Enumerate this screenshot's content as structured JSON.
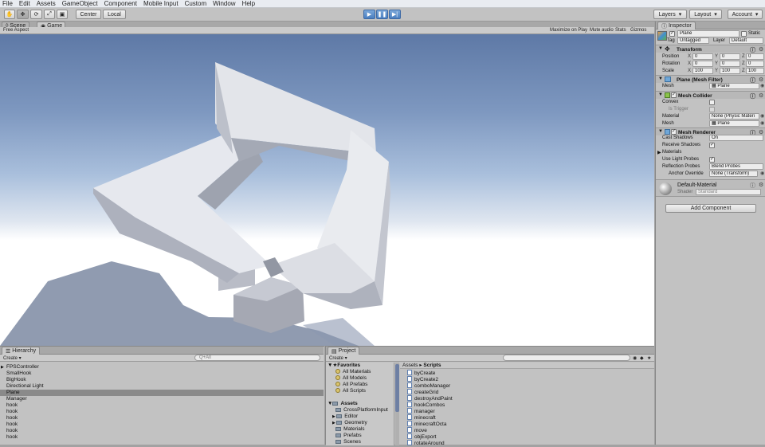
{
  "menu": [
    "File",
    "Edit",
    "Assets",
    "GameObject",
    "Component",
    "Mobile Input",
    "Custom",
    "Window",
    "Help"
  ],
  "toolbar": {
    "pivot": "Center",
    "space": "Local",
    "layers": "Layers",
    "layout": "Layout",
    "account": "Account"
  },
  "scene_tabs": {
    "scene": "Scene",
    "game": "Game"
  },
  "game_bar": {
    "aspect": "Free Aspect",
    "maximize": "Maximize on Play",
    "mute": "Mute audio",
    "stats": "Stats",
    "gizmos": "Gizmos"
  },
  "inspector": {
    "tab": "Inspector",
    "object_name": "Plane",
    "static_label": "Static",
    "tag_label": "Tag",
    "tag_value": "Untagged",
    "layer_label": "Layer",
    "layer_value": "Default",
    "transform": {
      "title": "Transform",
      "position_label": "Position",
      "rotation_label": "Rotation",
      "scale_label": "Scale",
      "position": [
        "0",
        "0",
        "0"
      ],
      "rotation": [
        "0",
        "0",
        "0"
      ],
      "scale": [
        "100",
        "100",
        "100"
      ]
    },
    "mesh_filter": {
      "title": "Plane (Mesh Filter)",
      "mesh_label": "Mesh",
      "mesh_value": "Plane"
    },
    "mesh_collider": {
      "title": "Mesh Collider",
      "convex_label": "Convex",
      "trigger_label": "Is Trigger",
      "material_label": "Material",
      "material_value": "None (Physic Materi",
      "mesh_label": "Mesh",
      "mesh_value": "Plane"
    },
    "mesh_renderer": {
      "title": "Mesh Renderer",
      "cast_label": "Cast Shadows",
      "cast_value": "On",
      "receive_label": "Receive Shadows",
      "materials_label": "Materials",
      "probes_label": "Use Light Probes",
      "reflection_label": "Reflection Probes",
      "reflection_value": "Blend Probes",
      "anchor_label": "Anchor Override",
      "anchor_value": "None (Transform)"
    },
    "material": {
      "name": "Default-Material",
      "shader_label": "Shader",
      "shader_value": "Standard"
    },
    "add_component": "Add Component"
  },
  "hierarchy": {
    "tab": "Hierarchy",
    "create": "Create",
    "search_placeholder": "Q+All",
    "items": [
      "FPSController",
      "SmallHook",
      "BigHook",
      "Directional Light",
      "Plane",
      "Manager",
      "hook",
      "hook",
      "hook",
      "hook",
      "hook",
      "hook"
    ],
    "selected_index": 4
  },
  "project": {
    "tab": "Project",
    "create": "Create",
    "favorites_label": "Favorites",
    "favorites": [
      "All Materials",
      "All Models",
      "All Prefabs",
      "All Scripts"
    ],
    "assets_label": "Assets",
    "folders": [
      "CrossPlatformInput",
      "Editor",
      "Geometry",
      "Materials",
      "Prefabs",
      "Scenes"
    ],
    "breadcrumb_root": "Assets",
    "breadcrumb_sep": "▸",
    "breadcrumb_current": "Scripts",
    "scripts": [
      "byCreate",
      "byCreate2",
      "comboManager",
      "createGrid",
      "destroyAndPaint",
      "hookCombos",
      "manager",
      "minecraft",
      "minecraftOcta",
      "move",
      "objExport",
      "rotateAround"
    ]
  },
  "colors": {
    "sky_top": "#5e79a6",
    "selection": "#8a8a8a",
    "play_blue": "#4a7fc0",
    "panel": "#c2c2c2"
  }
}
